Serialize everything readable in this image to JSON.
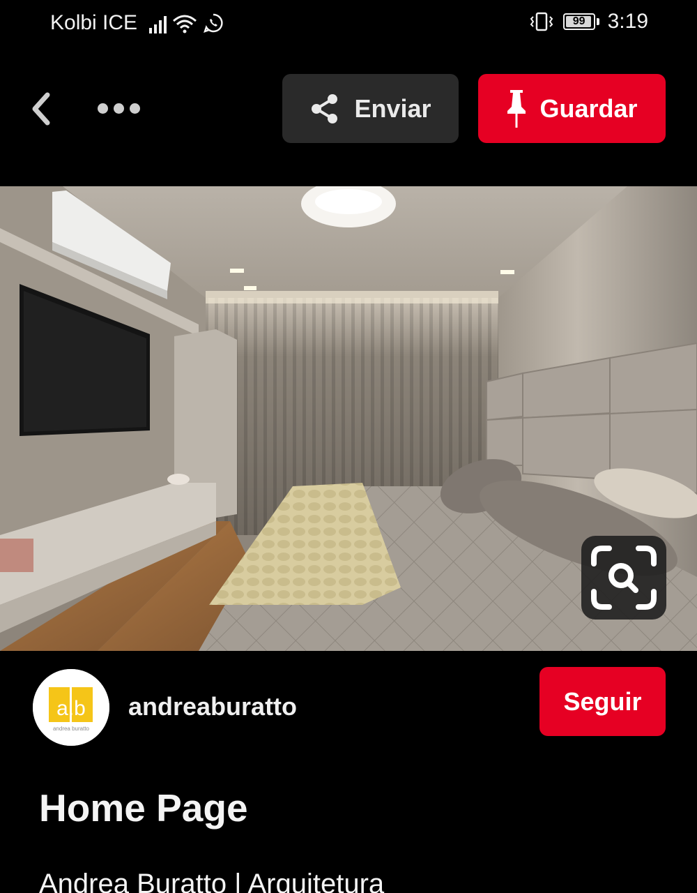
{
  "status_bar": {
    "carrier": "Kolbi ICE",
    "battery": "99",
    "time": "3:19",
    "icons": [
      "signal-icon",
      "wifi-icon",
      "whatsapp-icon",
      "vibrate-icon",
      "battery-icon"
    ]
  },
  "toolbar": {
    "back_icon": "chevron-left-icon",
    "more_icon": "more-dots-icon",
    "share_label": "Enviar",
    "save_label": "Guardar"
  },
  "pin": {
    "image_icon": "visual-search-icon",
    "author": "andreaburatto",
    "avatar_logo_text": "a.b",
    "avatar_sub_text": "andrea buratto",
    "follow_label": "Seguir",
    "title": "Home Page",
    "description": "Andrea Buratto | Arquitetura"
  },
  "colors": {
    "brand_red": "#e60023",
    "share_button_bg": "#2a2a2a",
    "background": "#000000",
    "avatar_yellow": "#f5c518"
  }
}
